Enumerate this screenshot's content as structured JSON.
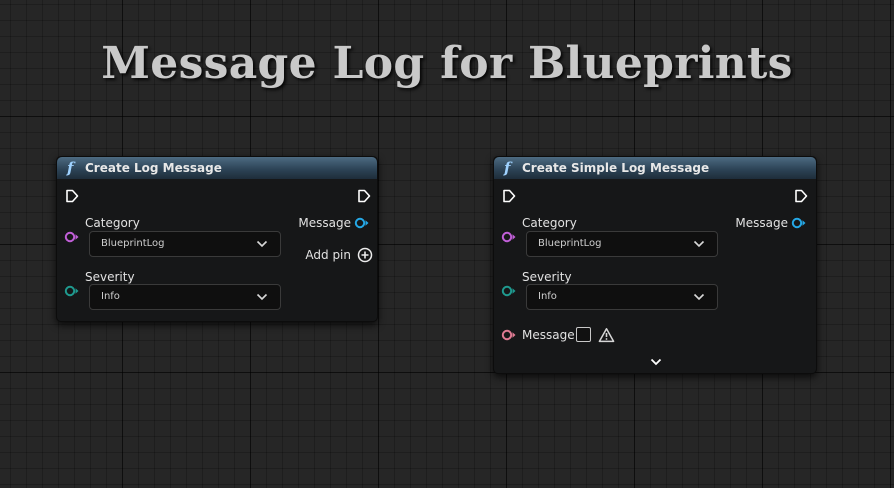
{
  "page": {
    "title": "Message Log for Blueprints"
  },
  "colors": {
    "header": "#2d4457",
    "func_icon": "#9fd2ff",
    "pin_category": "#c15fd8",
    "pin_severity": "#1f9a8f",
    "pin_message_out": "#25a8e6",
    "pin_message_in": "#e07b93",
    "exec_pin": "#ffffff"
  },
  "nodes": [
    {
      "title": "Create Log Message",
      "function_icon": "f",
      "category": {
        "label": "Category",
        "value": "BlueprintLog",
        "icon": "chevron-down-icon"
      },
      "severity": {
        "label": "Severity",
        "value": "Info",
        "icon": "chevron-down-icon"
      },
      "outputs": {
        "message_label": "Message",
        "add_pin_label": "Add pin",
        "add_pin_icon": "plus-circle-icon"
      }
    },
    {
      "title": "Create Simple Log Message",
      "function_icon": "f",
      "category": {
        "label": "Category",
        "value": "BlueprintLog",
        "icon": "chevron-down-icon"
      },
      "severity": {
        "label": "Severity",
        "value": "Info",
        "icon": "chevron-down-icon"
      },
      "message_input": {
        "label": "Message",
        "warning_icon": "warning-icon"
      },
      "outputs": {
        "message_label": "Message"
      },
      "expand_icon": "chevron-down-icon"
    }
  ]
}
